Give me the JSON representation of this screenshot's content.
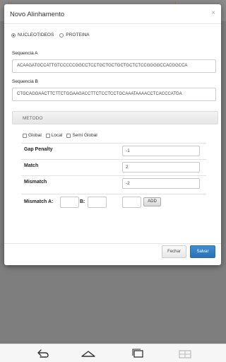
{
  "modal": {
    "title": "Novo Alinhamento",
    "close_label": "×"
  },
  "type_options": [
    {
      "label": "NUCLEOTIDEOS",
      "selected": true
    },
    {
      "label": "PROTEINA",
      "selected": false
    }
  ],
  "sequence_a": {
    "label": "Sequencia A",
    "value": "ACAAGATGCCATTGTCCCCCGGCCTCCTGCTGCTGCTGCTCTCCGGGGCCACGGCCA"
  },
  "sequence_b": {
    "label": "Sequencia B",
    "value": "CTGCAGGAACTTCTTCTGGAAGACCTTCTCCTCCTGCAAATAAAACCTCACCCATGA"
  },
  "method": {
    "header": "METODO",
    "options": [
      "Global",
      "Local",
      "Semi Global"
    ]
  },
  "params": {
    "gap_penalty": {
      "label": "Gap Penalty",
      "value": "-1"
    },
    "match": {
      "label": "Match",
      "value": "2"
    },
    "mismatch": {
      "label": "Mismatch",
      "value": "-2"
    }
  },
  "mismatch_pair": {
    "label_a": "Mismatch A:",
    "label_b": "B:",
    "add_label": "ADD"
  },
  "footer": {
    "close_label": "Fechar",
    "save_label": "Salvar"
  },
  "navbar": {
    "icons": [
      "back-icon",
      "home-icon",
      "recent-apps-icon",
      "screenshot-icon"
    ]
  },
  "colors": {
    "primary": "#3a87cc",
    "overlay": "#7e7e7e"
  }
}
